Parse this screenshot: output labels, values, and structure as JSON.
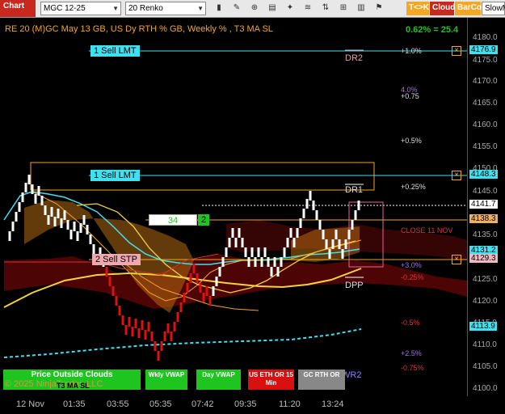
{
  "toolbar": {
    "chart_label": "Chart",
    "instrument": "MGC 12-25",
    "bar_type": "20 Renko",
    "tk_button": "T<>K",
    "cloud_button": "Cloud",
    "barcol_button": "BarCol",
    "slowm_button": "SlowM",
    "icons": [
      "bar-style-icon",
      "draw-tools-icon",
      "zoom-icon",
      "properties-icon",
      "strategy-icon",
      "indicators-icon",
      "data-series-icon",
      "chart-trader-icon",
      "template-icon"
    ]
  },
  "chart": {
    "title": "RE 20  (M)GC May 13 GB, US Dy RTH % GB, Weekly % , T3 MA SL",
    "change_text": "0.62% = 25.4",
    "copyright": "© 2025 NinjaTrader, LLC",
    "ma_label": "T3 MA SL",
    "dr2": "DR2",
    "dr1": "DR1",
    "dpp": "DPP",
    "wr2": "WR2",
    "close_label": "CLOSE 11 NOV",
    "pct_labels": [
      "+1.0%",
      "4.0%",
      "+0.75",
      "+0.5%",
      "+0.25%",
      "+3.0%",
      "-0.25%",
      "-0.5%",
      "+2.5%",
      "-0.75%"
    ],
    "orders": {
      "sell_lmt_1": "1 Sell LMT",
      "sell_lmt_2": "1 Sell LMT",
      "sell_stp": "2 Sell STP",
      "qty_left": "34",
      "qty_right": "2"
    },
    "buttons": {
      "price_outside": "Price Outside Clouds",
      "wkly_vwap": "Wkly VWAP",
      "day_vwap": "Day VWAP",
      "us_eth": "US ETH OR 15 Min",
      "gc_rth": "GC RTH OR"
    }
  },
  "price_axis": {
    "ticks": [
      "4180.0",
      "4175.0",
      "4170.0",
      "4165.0",
      "4160.0",
      "4155.0",
      "4150.0",
      "4145.0",
      "4135.0",
      "4125.0",
      "4120.0",
      "4115.0",
      "4110.0",
      "4105.0",
      "4100.0"
    ],
    "labels": {
      "sell_lmt_1": "4176.9",
      "sell_lmt_2": "4148.3",
      "last": "4141.7",
      "pos": "4138.3",
      "l1": "4131.2",
      "stop": "4129.3",
      "vwap": "4113.9"
    }
  },
  "time_axis": {
    "ticks": [
      "12 Nov",
      "01:35",
      "03:55",
      "05:35",
      "07:42",
      "09:35",
      "11:20",
      "13:24"
    ]
  },
  "colors": {
    "accent_orange": "#f5a623",
    "cyan": "#3fe0f0",
    "green": "#1ec51e",
    "red": "#d81010"
  }
}
